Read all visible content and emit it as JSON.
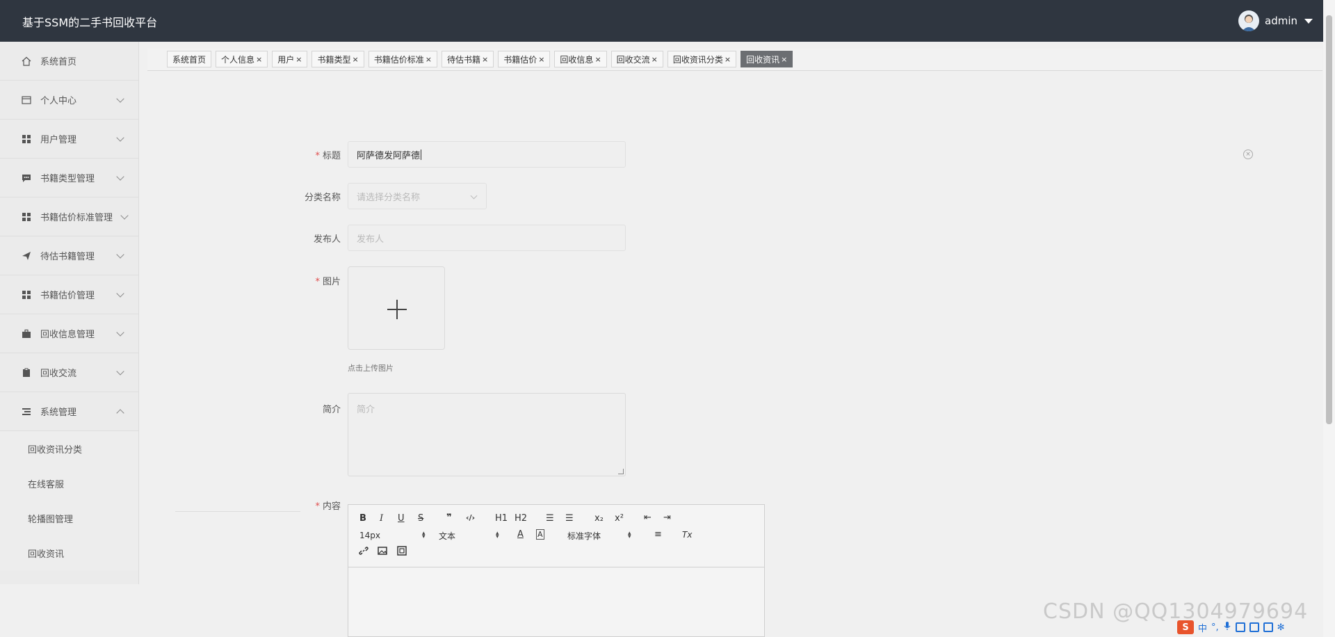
{
  "app": {
    "title": "基于SSM的二手书回收平台"
  },
  "user": {
    "name": "admin"
  },
  "sidebar": {
    "items": [
      {
        "label": "系统首页",
        "icon": "home-icon"
      },
      {
        "label": "个人中心",
        "icon": "folder-icon"
      },
      {
        "label": "用户管理",
        "icon": "grid-icon"
      },
      {
        "label": "书籍类型管理",
        "icon": "chat-icon"
      },
      {
        "label": "书籍估价标准管理",
        "icon": "grid-icon"
      },
      {
        "label": "待估书籍管理",
        "icon": "send-icon"
      },
      {
        "label": "书籍估价管理",
        "icon": "grid-icon"
      },
      {
        "label": "回收信息管理",
        "icon": "briefcase-icon"
      },
      {
        "label": "回收交流",
        "icon": "clipboard-icon"
      },
      {
        "label": "系统管理",
        "icon": "list-icon"
      }
    ],
    "sub_items": [
      "回收资讯分类",
      "在线客服",
      "轮播图管理",
      "回收资讯"
    ]
  },
  "tabs": [
    {
      "label": "系统首页",
      "close": ""
    },
    {
      "label": "个人信息",
      "close": "×"
    },
    {
      "label": "用户",
      "close": "×"
    },
    {
      "label": "书籍类型",
      "close": "×"
    },
    {
      "label": "书籍估价标准",
      "close": "×"
    },
    {
      "label": "待估书籍",
      "close": "×"
    },
    {
      "label": "书籍估价",
      "close": "×"
    },
    {
      "label": "回收信息",
      "close": "×"
    },
    {
      "label": "回收交流",
      "close": "×"
    },
    {
      "label": "回收资讯分类",
      "close": "×"
    },
    {
      "label": "回收资讯",
      "close": "×"
    }
  ],
  "form": {
    "required_mark": "*",
    "title": {
      "label": "标题",
      "value": "阿萨德发阿萨德"
    },
    "category": {
      "label": "分类名称",
      "placeholder": "请选择分类名称"
    },
    "publisher": {
      "label": "发布人",
      "placeholder": "发布人"
    },
    "image": {
      "label": "图片",
      "hint": "点击上传图片"
    },
    "intro": {
      "label": "简介",
      "placeholder": "简介"
    },
    "content": {
      "label": "内容"
    }
  },
  "editor": {
    "bold": "B",
    "italic": "I",
    "underline": "U",
    "strike": "S",
    "quote": "❞",
    "code": "‹/›",
    "h1": "H1",
    "h2": "H2",
    "ol": "☰",
    "ul": "☰",
    "sub": "x₂",
    "sup": "x²",
    "outdent": "⇤",
    "indent": "⇥",
    "size": "14px",
    "header": "文本",
    "font_color": "A",
    "bg_color": "A",
    "font": "标准字体",
    "align": "≡",
    "clean": "Tx",
    "link": "🔗",
    "image": "▣",
    "video": "▦"
  },
  "watermark": "CSDN @QQ1304979694",
  "ime": {
    "chinese": "中",
    "punct": "°,"
  }
}
